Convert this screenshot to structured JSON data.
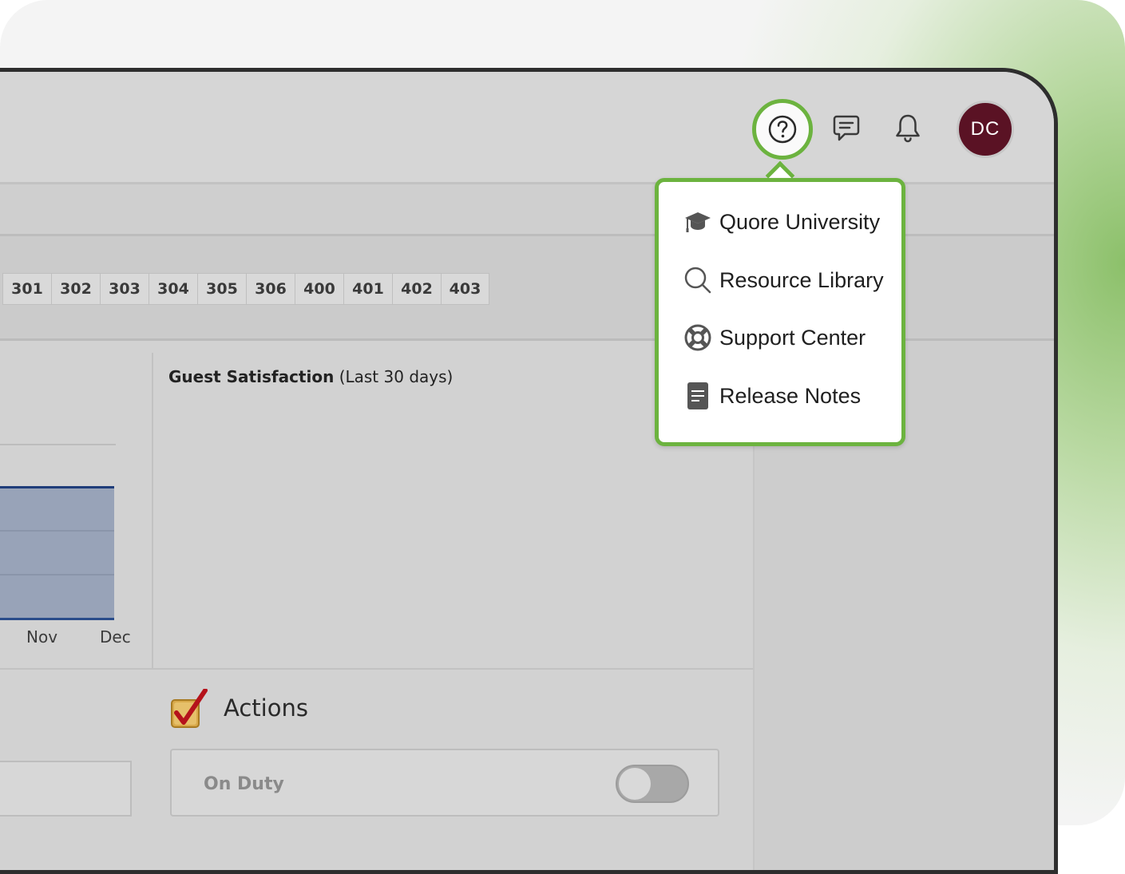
{
  "header": {
    "help_icon": "question-circle-icon",
    "chat_icon": "chat-icon",
    "bell_icon": "bell-icon",
    "avatar_initials": "DC"
  },
  "rooms": [
    "301",
    "302",
    "303",
    "304",
    "305",
    "306",
    "400",
    "401",
    "402",
    "403"
  ],
  "chart": {
    "x_labels": [
      "Nov",
      "Dec"
    ]
  },
  "guest_satisfaction": {
    "title": "Guest Satisfaction",
    "subtitle": "(Last 30 days)"
  },
  "actions": {
    "title": "Actions",
    "on_duty_label": "On Duty",
    "on_duty_enabled": false
  },
  "help_menu": {
    "items": [
      {
        "label": "Quore University",
        "icon": "graduation-cap-icon"
      },
      {
        "label": "Resource Library",
        "icon": "search-icon"
      },
      {
        "label": "Support Center",
        "icon": "lifebuoy-icon"
      },
      {
        "label": "Release Notes",
        "icon": "document-icon"
      }
    ]
  },
  "colors": {
    "highlight_green": "#6cb33f",
    "avatar_bg": "#5a1224",
    "chart_fill": "#98a3b8",
    "chart_line": "#1f3d7a"
  }
}
